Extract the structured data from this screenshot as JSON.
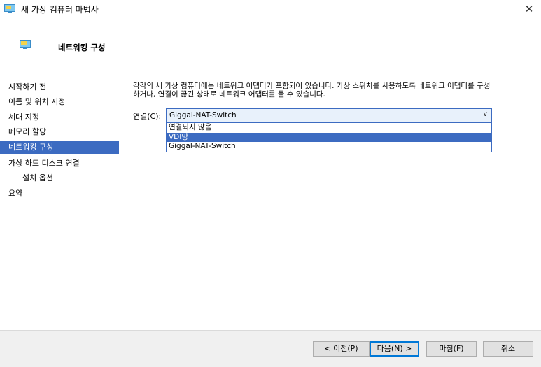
{
  "window": {
    "title": "새 가상 컴퓨터 마법사",
    "close": "✕"
  },
  "header": {
    "title": "네트워킹 구성"
  },
  "sidebar": {
    "items": [
      {
        "label": "시작하기 전"
      },
      {
        "label": "이름 및 위치 지정"
      },
      {
        "label": "세대 지정"
      },
      {
        "label": "메모리 할당"
      },
      {
        "label": "네트워킹 구성"
      },
      {
        "label": "가상 하드 디스크 연결"
      },
      {
        "label": "설치 옵션"
      },
      {
        "label": "요약"
      }
    ]
  },
  "main": {
    "description_line1": "각각의 새 가상 컴퓨터에는 네트워크 어댑터가 포함되어 있습니다. 가상 스위치를 사용하도록 네트워크 어댑터를 구성",
    "description_line2": "하거나, 연결이 끊긴 상태로 네트워크 어댑터를 둘 수 있습니다.",
    "connection_label": "연결(C):",
    "connection_value": "Giggal-NAT-Switch",
    "options": [
      {
        "label": "연결되지 않음"
      },
      {
        "label": "VDI망"
      },
      {
        "label": "Giggal-NAT-Switch"
      }
    ]
  },
  "footer": {
    "prev": "< 이전(P)",
    "next": "다음(N) >",
    "finish": "마침(F)",
    "cancel": "취소"
  },
  "colors": {
    "accent": "#3c6bc1",
    "button_focus": "#0078d7"
  }
}
